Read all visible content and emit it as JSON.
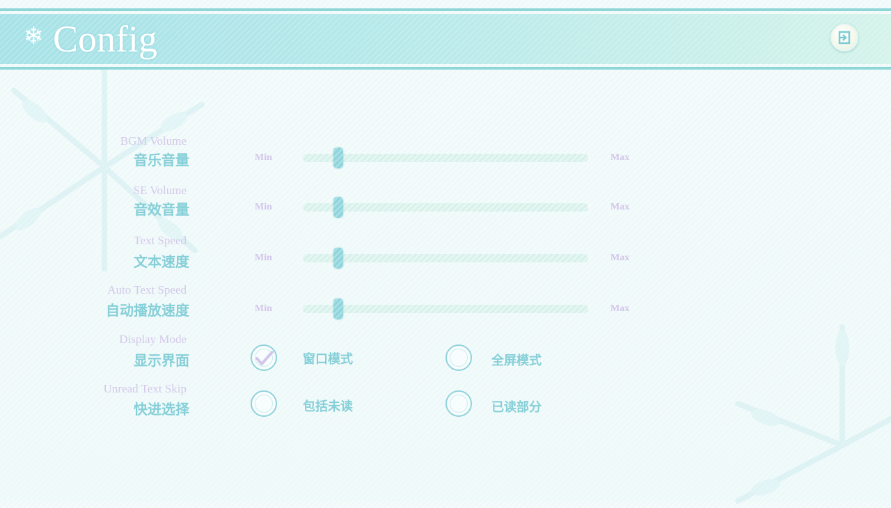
{
  "header": {
    "title": "Config",
    "icon": "snowflake-icon",
    "exit_icon": "exit-icon"
  },
  "settings": {
    "bgm": {
      "label_en": "BGM Volume",
      "label_zh": "音乐音量",
      "min": "Min",
      "max": "Max",
      "value": 0.11
    },
    "se": {
      "label_en": "SE Volume",
      "label_zh": "音效音量",
      "min": "Min",
      "max": "Max",
      "value": 0.11
    },
    "text_speed": {
      "label_en": "Text Speed",
      "label_zh": "文本速度",
      "min": "Min",
      "max": "Max",
      "value": 0.11
    },
    "auto_speed": {
      "label_en": "Auto Text Speed",
      "label_zh": "自动播放速度",
      "min": "Min",
      "max": "Max",
      "value": 0.11
    },
    "display_mode": {
      "label_en": "Display Mode",
      "label_zh": "显示界面",
      "options": [
        {
          "label": "窗口模式",
          "selected": true
        },
        {
          "label": "全屏模式",
          "selected": false
        }
      ]
    },
    "skip": {
      "label_en": "Unread Text Skip",
      "label_zh": "快进选择",
      "options": [
        {
          "label": "包括未读",
          "selected": false
        },
        {
          "label": "已读部分",
          "selected": false
        }
      ]
    }
  },
  "colors": {
    "accent": "#86cfd8",
    "secondary": "#d4c8ea",
    "track": "#d7f1ea"
  }
}
